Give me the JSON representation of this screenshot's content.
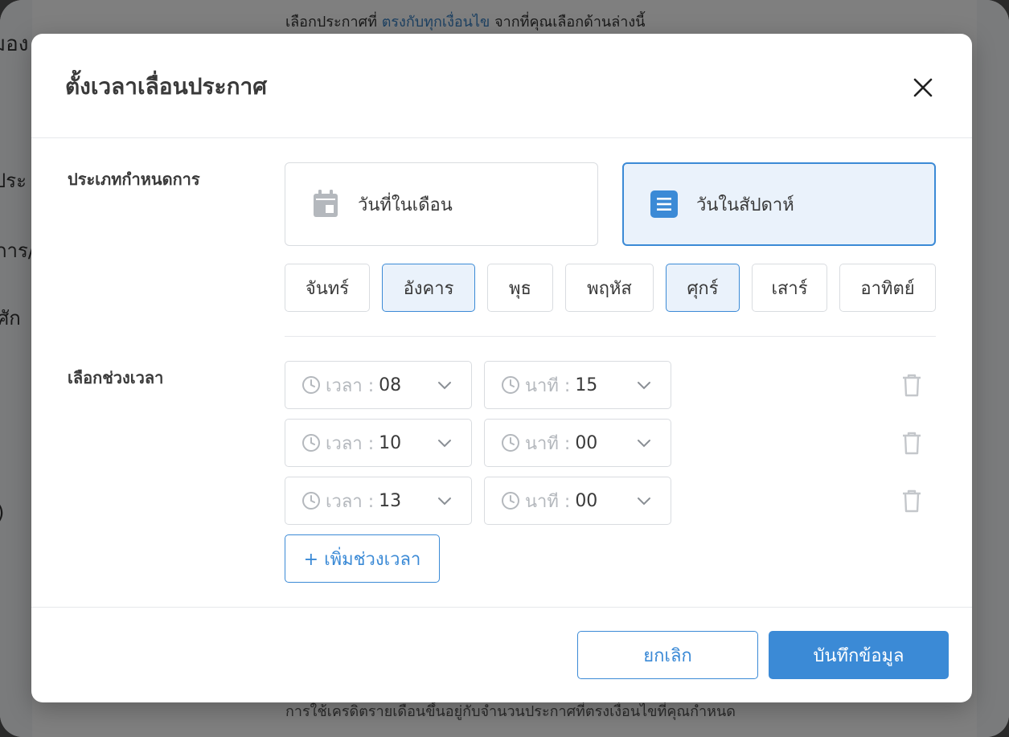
{
  "background": {
    "top_text_before": "เลือกประกาศที่",
    "top_text_highlight": "ตรงกับทุกเงื่อนไข",
    "top_text_after": "จากที่คุณเลือกด้านล่างนี้",
    "bottom_text": "การใช้เครดิตรายเดือนขึ้นอยู่กับจำนวนประกาศที่ตรงเงื่อนไขที่คุณกำหนด",
    "left_fragments": [
      "มอง",
      "ประ",
      "การ/",
      "ศัก",
      ")"
    ]
  },
  "modal": {
    "title": "ตั้งเวลาเลื่อนประกาศ",
    "schedule_type_label": "ประเภทกำหนดการ",
    "schedule_types": [
      {
        "label": "วันที่ในเดือน",
        "icon": "calendar-icon",
        "selected": false
      },
      {
        "label": "วันในสัปดาห์",
        "icon": "list-icon",
        "selected": true
      }
    ],
    "days": [
      {
        "label": "จันทร์",
        "selected": false
      },
      {
        "label": "อังคาร",
        "selected": true
      },
      {
        "label": "พุธ",
        "selected": false
      },
      {
        "label": "พฤหัส",
        "selected": false
      },
      {
        "label": "ศุกร์",
        "selected": true
      },
      {
        "label": "เสาร์",
        "selected": false
      },
      {
        "label": "อาทิตย์",
        "selected": false
      }
    ],
    "time_label": "เลือกช่วงเวลา",
    "hour_prefix": "เวลา :",
    "minute_prefix": "นาที :",
    "time_slots": [
      {
        "hour": "08",
        "minute": "15"
      },
      {
        "hour": "10",
        "minute": "00"
      },
      {
        "hour": "13",
        "minute": "00"
      }
    ],
    "add_slot_label": "+ เพิ่มช่วงเวลา",
    "cancel_label": "ยกเลิก",
    "save_label": "บันทึกข้อมูล"
  },
  "colors": {
    "accent": "#3b8ad6",
    "selected_bg": "#eaf2fb",
    "border": "#d9dce0",
    "muted": "#b4b8bd"
  }
}
